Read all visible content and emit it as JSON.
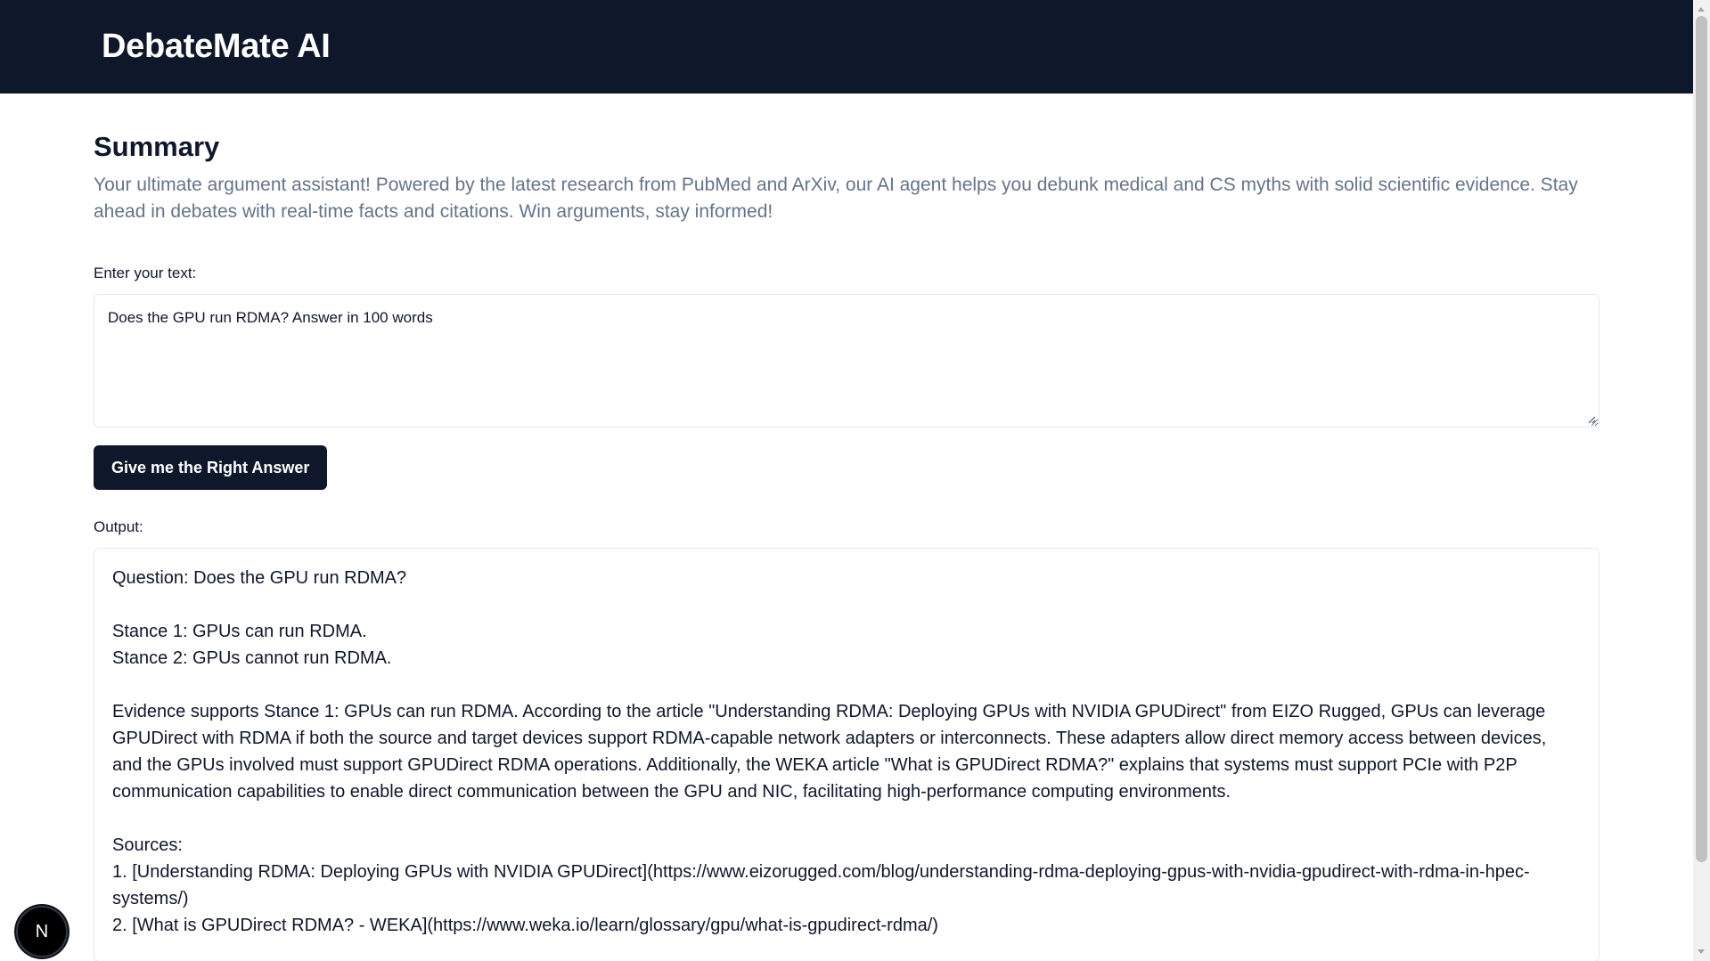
{
  "header": {
    "brand": "DebateMate AI"
  },
  "summary": {
    "title": "Summary",
    "description": "Your ultimate argument assistant! Powered by the latest research from PubMed and ArXiv, our AI agent helps you debunk medical and CS myths with solid scientific evidence. Stay ahead in debates with real-time facts and citations. Win arguments, stay informed!"
  },
  "input": {
    "label": "Enter your text:",
    "value": "Does the GPU run RDMA? Answer in 100 words"
  },
  "submit": {
    "label": "Give me the Right Answer"
  },
  "output": {
    "label": "Output:",
    "question": "Question: Does the GPU run RDMA?",
    "stance1": "Stance 1: GPUs can run RDMA.",
    "stance2": "Stance 2: GPUs cannot run RDMA.",
    "evidence": "Evidence supports Stance 1: GPUs can run RDMA. According to the article \"Understanding RDMA: Deploying GPUs with NVIDIA GPUDirect\" from EIZO Rugged, GPUs can leverage GPUDirect with RDMA if both the source and target devices support RDMA-capable network adapters or interconnects. These adapters allow direct memory access between devices, and the GPUs involved must support GPUDirect RDMA operations. Additionally, the WEKA article \"What is GPUDirect RDMA?\" explains that systems must support PCIe with P2P communication capabilities to enable direct communication between the GPU and NIC, facilitating high-performance computing environments.",
    "sources_heading": "Sources:",
    "sources": [
      "1. [Understanding RDMA: Deploying GPUs with NVIDIA GPUDirect](https://www.eizorugged.com/blog/understanding-rdma-deploying-gpus-with-nvidia-gpudirect-with-rdma-in-hpec-systems/)",
      "2. [What is GPUDirect RDMA? - WEKA](https://www.weka.io/learn/glossary/gpu/what-is-gpudirect-rdma/)"
    ]
  },
  "dev_badge": {
    "letter": "N",
    "icon": "nextjs-logo-icon"
  }
}
